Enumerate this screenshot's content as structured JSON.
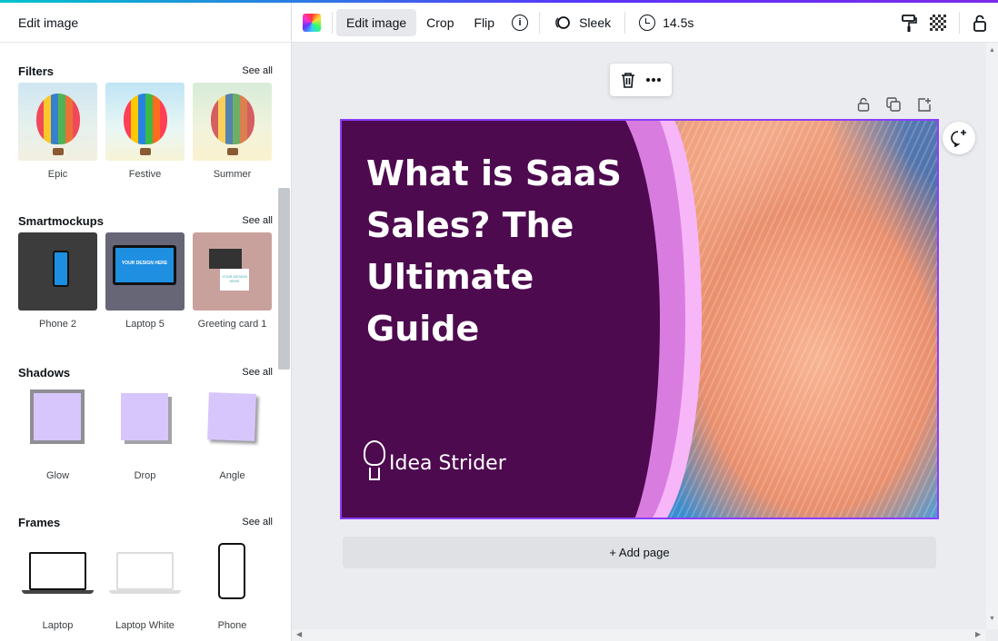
{
  "panel": {
    "title": "Edit image",
    "sections": {
      "filters": {
        "title": "Filters",
        "see_all": "See all",
        "items": [
          "Epic",
          "Festive",
          "Summer"
        ]
      },
      "smartmockups": {
        "title": "Smartmockups",
        "see_all": "See all",
        "items": [
          "Phone 2",
          "Laptop 5",
          "Greeting card 1"
        ]
      },
      "shadows": {
        "title": "Shadows",
        "see_all": "See all",
        "items": [
          "Glow",
          "Drop",
          "Angle"
        ]
      },
      "frames": {
        "title": "Frames",
        "see_all": "See all",
        "items": [
          "Laptop",
          "Laptop White",
          "Phone"
        ]
      }
    },
    "mockup_text": "YOUR DESIGN HERE"
  },
  "toolbar": {
    "edit_image": "Edit image",
    "crop": "Crop",
    "flip": "Flip",
    "info": "i",
    "animation": "Sleek",
    "duration": "14.5s",
    "color_icon": "color-picker-icon",
    "paint_icon": "paint-roller-icon",
    "transparency_icon": "transparency-icon",
    "lock_icon": "lock-icon"
  },
  "canvas": {
    "design_title": "What is SaaS Sales? The Ultimate Guide",
    "brand_name": "Idea Strider",
    "add_page": "+ Add page",
    "colors": {
      "background": "#4d0a4f",
      "selection": "#8b3dff",
      "wave_light": "#f6b6f8",
      "wave_mid": "#d97ce0"
    }
  }
}
